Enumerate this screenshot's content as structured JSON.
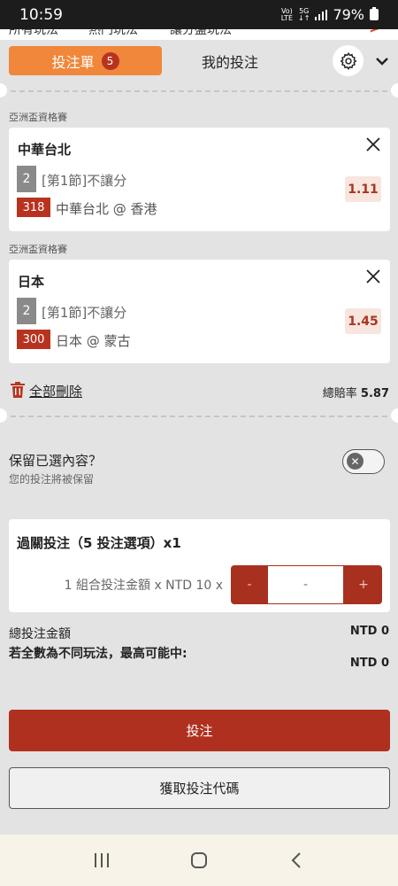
{
  "status_bar": {
    "time": "10:59",
    "network_top": "Vo)",
    "network_bottom": "LTE",
    "net5g": "5G",
    "battery": "79%"
  },
  "background_tabs": [
    "所有玩法",
    "熱門玩法",
    "讓分盤玩法"
  ],
  "header": {
    "bet_slip_tab": "投注單",
    "bet_count": "5",
    "my_bets_tab": "我的投注"
  },
  "bets": [
    {
      "league": "亞洲盃資格賽",
      "team": "中華台北",
      "period": "2",
      "market": "[第1節]不讓分",
      "match_id": "318",
      "match": "中華台北 @ 香港",
      "odds": "1.11"
    },
    {
      "league": "亞洲盃資格賽",
      "team": "日本",
      "period": "2",
      "market": "[第1節]不讓分",
      "match_id": "300",
      "match": "日本 @ 蒙古",
      "odds": "1.45"
    }
  ],
  "actions": {
    "delete_all": "全部刪除",
    "total_odds_label": "總賠率",
    "total_odds_value": "5.87"
  },
  "keep_selection": {
    "title": "保留已選內容？",
    "subtitle": "您的投注將被保留",
    "enabled": false
  },
  "parlay": {
    "title": "過關投注（5 投注選項）x1",
    "stake_label": "1 組合投注金額 x NTD 10 x",
    "minus": "-",
    "amount": "-",
    "plus": "+"
  },
  "summary": {
    "total_stake_label": "總投注金額",
    "total_stake_value": "NTD 0",
    "max_payout_label": "若全數為不同玩法，最高可能中:",
    "max_payout_value": "NTD 0"
  },
  "buttons": {
    "place_bet": "投注",
    "get_code": "獲取投注代碼"
  },
  "colors": {
    "accent_orange": "#f0873a",
    "brand_red": "#b0301f",
    "odds_bg": "#f7e5de"
  }
}
